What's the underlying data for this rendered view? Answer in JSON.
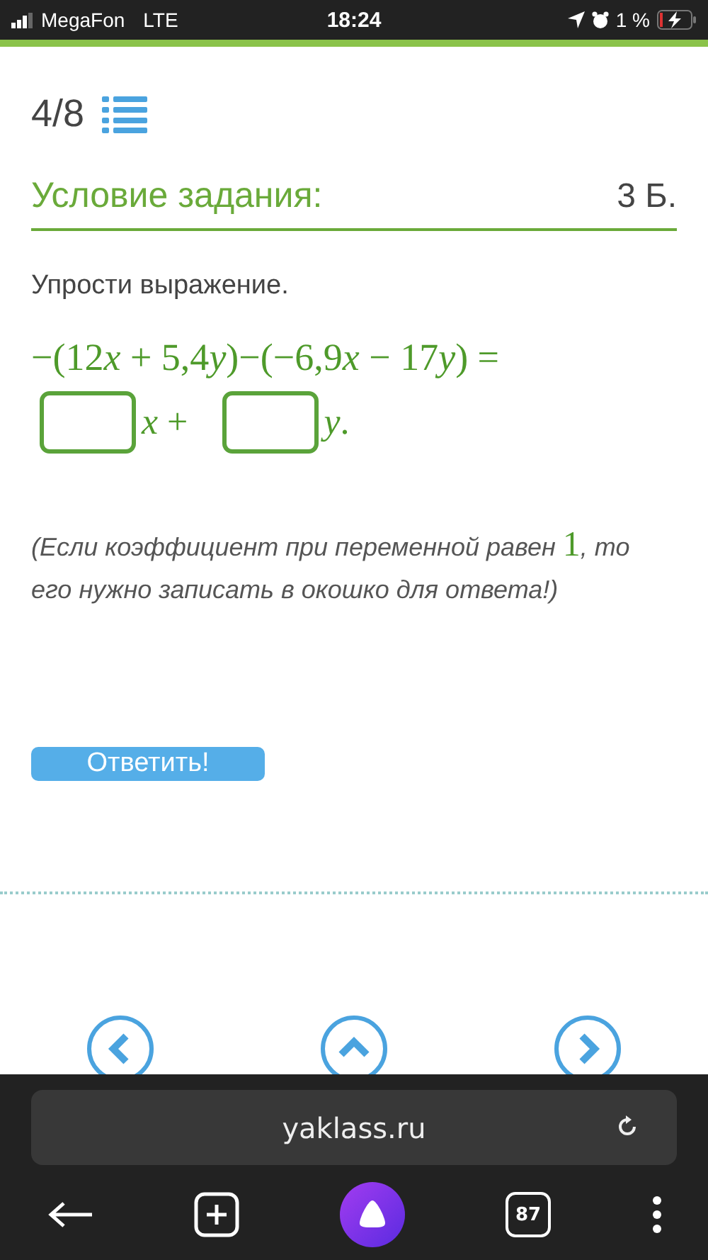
{
  "status_bar": {
    "carrier": "MegaFon",
    "network": "LTE",
    "time": "18:24",
    "battery_percent": "1 %"
  },
  "progress": {
    "counter": "4/8"
  },
  "task": {
    "title": "Условие задания:",
    "points": "3 Б.",
    "prompt": "Упрости выражение.",
    "equation": [
      {
        "text": "−(12",
        "italic": false
      },
      {
        "text": "x",
        "italic": true
      },
      {
        "text": " + 5,4",
        "italic": false
      },
      {
        "text": "y",
        "italic": true
      },
      {
        "text": ")−(−6,9",
        "italic": false
      },
      {
        "text": "x",
        "italic": true
      },
      {
        "text": " − 17",
        "italic": false
      },
      {
        "text": "y",
        "italic": true
      },
      {
        "text": ") =",
        "italic": false
      }
    ],
    "answer_terms": [
      {
        "variable": "x",
        "after": " +"
      },
      {
        "variable": "y",
        "after": "."
      }
    ],
    "note": {
      "before": "(Если коэффициент при переменной равен ",
      "number": "1",
      "after": ", то его нужно записать в окошко для ответа!)"
    },
    "submit": "Ответить!"
  },
  "browser": {
    "url": "yaklass.ru",
    "tabs_count": "87"
  }
}
